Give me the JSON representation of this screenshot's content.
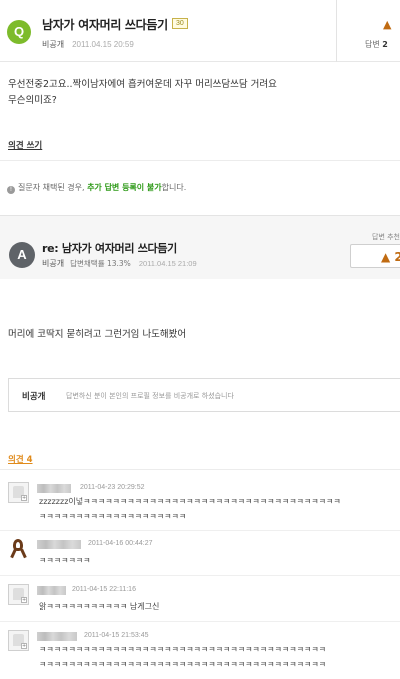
{
  "question": {
    "badge": "Q",
    "title": "남자가 여자머리 쓰다듬기",
    "level": "30",
    "author": "비공개",
    "date": "2011.04.15 20:59",
    "recommend_icon": "thumbs-up-icon",
    "answers_label": "답변",
    "answers_count": "2",
    "body_line1": "우선전중2고요..짝이남자에여 흡커여운데 자꾸 머리쓰담쓰담 거려요",
    "body_line2": "무슨의미죠?"
  },
  "opinion_write": "의견 쓰기",
  "notice": {
    "prefix": "질문자 채택된 경우,",
    "highlight": "추가 답변 등록이 불가",
    "suffix": "합니다."
  },
  "answer": {
    "badge": "A",
    "title": "re: 남자가 여자머리 쓰다듬기",
    "author": "비공개",
    "rate": "답변채택률 13.3%",
    "date": "2011.04.15 21:09",
    "vote_label": "답변 추천",
    "vote_count": "2",
    "body": "머리에 코딱지 묻히려고 그런거임 나도해봤어"
  },
  "profile": {
    "name": "비공개",
    "desc": "답변하신 분이 본인의 프로필 정보를 비공개로 하셨습니다"
  },
  "opinions": {
    "header": "의견 4",
    "items": [
      {
        "date": "2011-04-23 20:29:52",
        "line1": "zzzzzzz이넣ㅋㅋㅋㅋㅋㅋㅋㅋㅋㅋㅋㅋㅋㅋㅋㅋㅋㅋㅋㅋㅋㅋㅋㅋㅋㅋㅋㅋㅋㅋㅋㅋㅋㅋㅋ",
        "line2": "ㅋㅋㅋㅋㅋㅋㅋㅋㅋㅋㅋㅋㅋㅋㅋㅋㅋㅋㅋㅋ"
      },
      {
        "date": "2011-04-16 00:44:27",
        "line1": "ㅋㅋㅋㅋㅋㅋㅋ"
      },
      {
        "date": "2011-04-15 22:11:16",
        "line1": "앍ㅋㅋㅋㅋㅋㅋㅋㅋㅋㅋㅋ 남게그신"
      },
      {
        "date": "2011-04-15 21:53:45",
        "line1": "ㅋㅋㅋㅋㅋㅋㅋㅋㅋㅋㅋㅋㅋㅋㅋㅋㅋㅋㅋㅋㅋㅋㅋㅋㅋㅋㅋㅋㅋㅋㅋㅋㅋㅋㅋㅋㅋㅋㅋ",
        "line2": "ㅋㅋㅋㅋㅋㅋㅋㅋㅋㅋㅋㅋㅋㅋㅋㅋㅋㅋㅋㅋㅋㅋㅋㅋㅋㅋㅋㅋㅋㅋㅋㅋㅋㅋㅋㅋㅋㅋㅋ"
      }
    ]
  }
}
